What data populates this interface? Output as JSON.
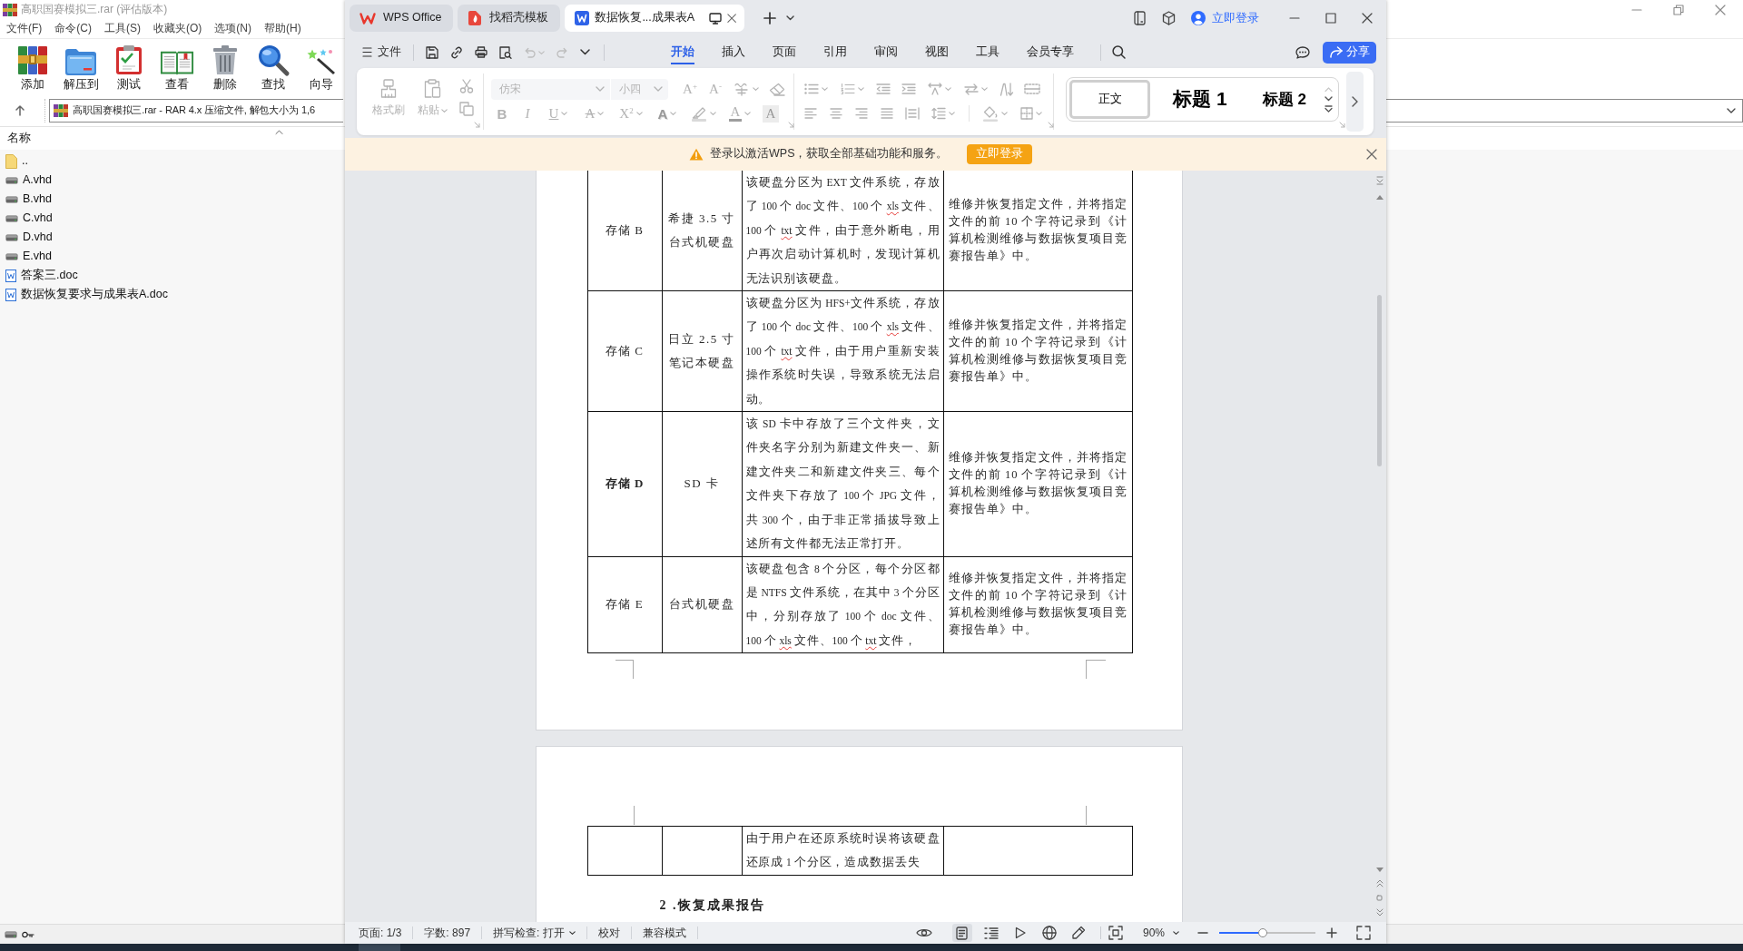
{
  "winrar": {
    "title": "高职国赛模拟三.rar (评估版本)",
    "menu": [
      "文件(F)",
      "命令(C)",
      "工具(S)",
      "收藏夹(O)",
      "选项(N)",
      "帮助(H)"
    ],
    "toolbar": [
      {
        "label": "添加",
        "kind": "add"
      },
      {
        "label": "解压到",
        "kind": "extract"
      },
      {
        "label": "测试",
        "kind": "test"
      },
      {
        "label": "查看",
        "kind": "view"
      },
      {
        "label": "删除",
        "kind": "delete"
      },
      {
        "label": "查找",
        "kind": "find"
      },
      {
        "label": "向导",
        "kind": "wizard"
      }
    ],
    "address": "高职国赛模拟三.rar - RAR 4.x 压缩文件, 解包大小为 1,6",
    "columns": [
      "名称"
    ],
    "files": [
      {
        "name": "..",
        "kind": "parent"
      },
      {
        "name": "A.vhd",
        "kind": "disk"
      },
      {
        "name": "B.vhd",
        "kind": "disk"
      },
      {
        "name": "C.vhd",
        "kind": "disk"
      },
      {
        "name": "D.vhd",
        "kind": "disk"
      },
      {
        "name": "E.vhd",
        "kind": "disk"
      },
      {
        "name": "答案三.doc",
        "kind": "doc"
      },
      {
        "name": "数据恢复要求与成果表A.doc",
        "kind": "doc"
      }
    ]
  },
  "wps": {
    "tabs": [
      {
        "label": "WPS Office",
        "kind": "home",
        "selected": false
      },
      {
        "label": "找稻壳模板",
        "kind": "docer",
        "selected": false
      },
      {
        "label": "数据恢复...成果表A",
        "kind": "writer",
        "selected": true
      }
    ],
    "account": "立即登录",
    "file_menu": "文件",
    "quick_tools": [
      {
        "kind": "save",
        "disabled": false
      },
      {
        "kind": "link",
        "disabled": false
      },
      {
        "kind": "print",
        "disabled": false
      },
      {
        "kind": "preview",
        "disabled": false
      },
      {
        "kind": "undo",
        "disabled": true
      },
      {
        "kind": "redo",
        "disabled": true
      },
      {
        "kind": "more",
        "disabled": false
      }
    ],
    "ribbon_tabs": [
      {
        "label": "开始",
        "selected": true
      },
      {
        "label": "插入",
        "selected": false
      },
      {
        "label": "页面",
        "selected": false
      },
      {
        "label": "引用",
        "selected": false
      },
      {
        "label": "审阅",
        "selected": false
      },
      {
        "label": "视图",
        "selected": false
      },
      {
        "label": "工具",
        "selected": false
      },
      {
        "label": "会员专享",
        "selected": false
      }
    ],
    "share": "分享",
    "ribbon": {
      "disabled": true,
      "format_painter": "格式刷",
      "paste": "粘贴",
      "font": "仿宋",
      "size": "小四",
      "font_row_1": [
        {
          "kind": "grow",
          "label": "A$^{+}$",
          "dropdown": false
        },
        {
          "kind": "shrink",
          "label": "A$^{-}$",
          "dropdown": false
        },
        {
          "kind": "phonetic",
          "dropdown": true
        },
        {
          "kind": "clear",
          "dropdown": false
        }
      ],
      "font_row_2": [
        {
          "kind": "bold",
          "label": "B",
          "dropdown": false
        },
        {
          "kind": "italic",
          "label": "I",
          "dropdown": false
        },
        {
          "kind": "underline",
          "label": "U",
          "dropdown": true
        },
        {
          "kind": "strike",
          "label": "A",
          "dropdown": true
        },
        {
          "kind": "superscript",
          "label": "X$^{2}$",
          "dropdown": true
        },
        {
          "kind": "effect",
          "label": "A",
          "dropdown": true
        },
        {
          "kind": "highlight",
          "dropdown": true
        },
        {
          "kind": "color",
          "label": "A",
          "dropdown": true
        },
        {
          "kind": "shade",
          "label": "A",
          "dropdown": false
        }
      ],
      "paragraph_row_1": [
        {
          "kind": "bullets",
          "dropdown": true
        },
        {
          "kind": "numbering",
          "dropdown": true
        },
        {
          "kind": "outdent",
          "dropdown": false
        },
        {
          "kind": "indent",
          "dropdown": false
        },
        {
          "kind": "spacing",
          "dropdown": true
        },
        {
          "kind": "direction",
          "dropdown": true
        },
        {
          "kind": "sort",
          "dropdown": false
        },
        {
          "kind": "grid",
          "dropdown": false
        }
      ],
      "paragraph_row_2": [
        {
          "kind": "align_left",
          "dropdown": false
        },
        {
          "kind": "align_center",
          "dropdown": false
        },
        {
          "kind": "align_right",
          "dropdown": false
        },
        {
          "kind": "justify",
          "dropdown": false
        },
        {
          "kind": "distribute",
          "dropdown": false
        },
        {
          "kind": "line_spacing",
          "dropdown": true
        },
        {
          "kind": "fill",
          "dropdown": true
        },
        {
          "kind": "border",
          "dropdown": true
        }
      ],
      "styles": [
        {
          "label": "正文",
          "kind": "body",
          "selected": true
        },
        {
          "label": "标题 1",
          "kind": "heading1",
          "selected": false
        },
        {
          "label": "标题 2",
          "kind": "heading2",
          "selected": false
        }
      ]
    },
    "notice": {
      "text": "登录以激活WPS，获取全部基础功能和服务。",
      "button": "立即登录"
    },
    "document": {
      "rows": [
        {
          "name": "存储 B",
          "bold": false,
          "device": "希捷 3.5 寸台式机硬盘",
          "description": [
            {
              "text": "该硬盘分区为 EXT 文件系统，存放了 100 个 doc 文件、100 个 ",
              "flagged": false
            },
            {
              "text": "xls",
              "flagged": true
            },
            {
              "text": " 文件、100 个 ",
              "flagged": false
            },
            {
              "text": "txt",
              "flagged": true
            },
            {
              "text": " 文件，由于意外断电，用户再次启动计算机时，发现计算机无法识别该硬盘。",
              "flagged": false
            }
          ],
          "requirement": "维修并恢复指定文件，并将指定文件的前 10 个字符记录到《计算机检测维修与数据恢复项目竞赛报告单》中。"
        },
        {
          "name": "存储 C",
          "bold": false,
          "device": "日立 2.5 寸笔记本硬盘",
          "description": [
            {
              "text": "该硬盘分区为 HFS+文件系统，存放了 100 个 doc 文件、100 个 ",
              "flagged": false
            },
            {
              "text": "xls",
              "flagged": true
            },
            {
              "text": " 文件、100 个 ",
              "flagged": false
            },
            {
              "text": "txt",
              "flagged": true
            },
            {
              "text": " 文件，由于用户重新安装操作系统时失误，导致系统无法启动。",
              "flagged": false
            }
          ],
          "requirement": "维修并恢复指定文件，并将指定文件的前 10 个字符记录到《计算机检测维修与数据恢复项目竞赛报告单》中。"
        },
        {
          "name": "存储 D",
          "bold": true,
          "device": "SD 卡",
          "description": [
            {
              "text": "该 SD 卡中存放了三个文件夹，文件夹名字分别为新建文件夹一、新建文件夹二和新建文件夹三、每个文件夹下存放了 100 个 JPG 文件，共 300 个，由于非正常插拔导致上述所有文件都无法正常打开。",
              "flagged": false
            }
          ],
          "requirement": "维修并恢复指定文件，并将指定文件的前 10 个字符记录到《计算机检测维修与数据恢复项目竞赛报告单》中。"
        },
        {
          "name": "存储 E",
          "bold": false,
          "device": "台式机硬盘",
          "description": [
            {
              "text": "该硬盘包含 8 个分区，每个分区都是 NTFS 文件系统，在其中 3 个分区中，分别存放了 100 个 doc 文件、100 个 ",
              "flagged": false
            },
            {
              "text": "xls",
              "flagged": true
            },
            {
              "text": " 文件、100 个 ",
              "flagged": false
            },
            {
              "text": "txt",
              "flagged": true
            },
            {
              "text": " 文件，",
              "flagged": false
            }
          ],
          "requirement": "维修并恢复指定文件，并将指定文件的前 10 个字符记录到《计算机检测维修与数据恢复项目竞赛报告单》中。"
        }
      ],
      "next_page_rows": [
        {
          "description": [
            {
              "text": "由于用户在还原系统时误将该硬盘还原成 1 个分区，造成数据丢失",
              "flagged": false
            }
          ]
        }
      ],
      "heading": "2 .恢复成果报告"
    },
    "status_bar": {
      "items": [
        {
          "label": "页面: 1/3",
          "dropdown": false
        },
        {
          "label": "字数: 897",
          "dropdown": false
        },
        {
          "label": "拼写检查: 打开",
          "dropdown": true
        },
        {
          "label": "校对",
          "dropdown": false
        },
        {
          "label": "兼容模式",
          "dropdown": false
        }
      ],
      "views": [
        {
          "kind": "reading",
          "selected": false
        },
        {
          "kind": "page",
          "selected": true
        },
        {
          "kind": "outline",
          "selected": false
        },
        {
          "kind": "play",
          "selected": false
        },
        {
          "kind": "web",
          "selected": false
        },
        {
          "kind": "pen",
          "selected": false
        }
      ],
      "zoom": "90%",
      "zoom_slider": {
        "level": 0.45
      }
    }
  }
}
